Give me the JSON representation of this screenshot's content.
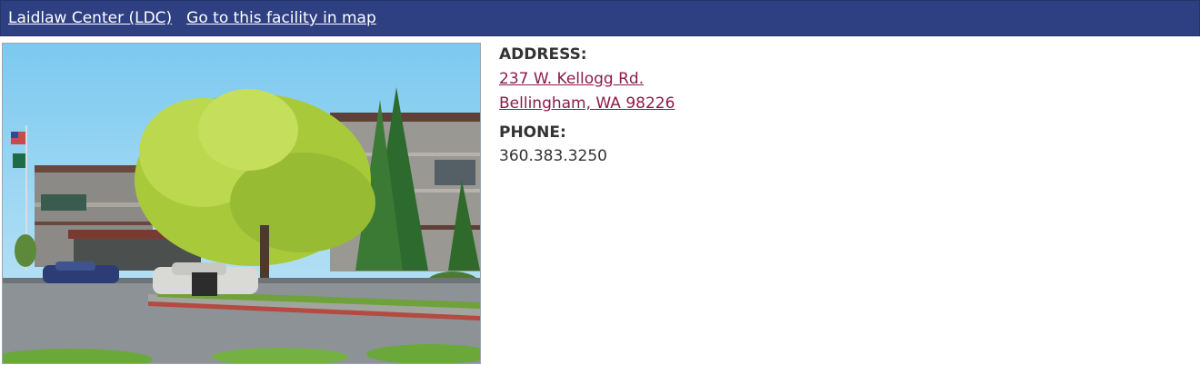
{
  "header": {
    "facility_name": "Laidlaw Center (LDC)",
    "map_link": "Go to this facility in map"
  },
  "photo": {
    "subject": "Laidlaw Center building exterior with trees, flags and parked cars"
  },
  "address": {
    "label": "ADDRESS:",
    "line1": "237 W. Kellogg Rd.",
    "line2": "Bellingham, WA 98226"
  },
  "phone": {
    "label": "PHONE:",
    "number": "360.383.3250"
  },
  "colors": {
    "header_bg": "#2e3f82",
    "link": "#8b1c4a",
    "text": "#333333"
  }
}
